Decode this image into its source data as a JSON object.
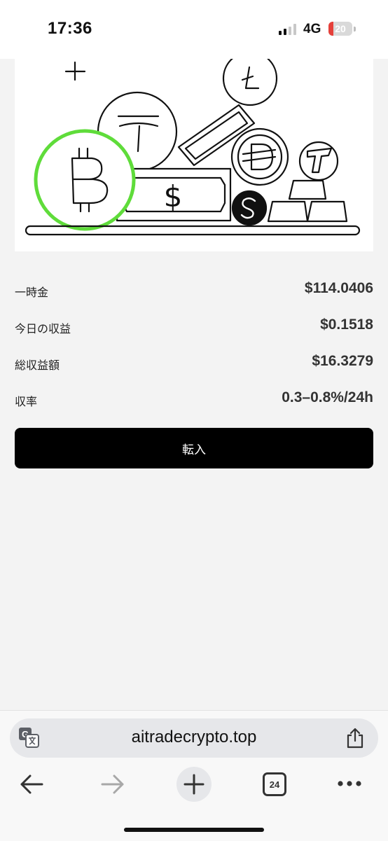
{
  "status_bar": {
    "time": "17:36",
    "network": "4G",
    "battery": "20",
    "battery_level": 0.2
  },
  "hero": {
    "icons": [
      "bitcoin-coin",
      "tether-coin",
      "litecoin-coin",
      "gold-bar",
      "dai-coin",
      "tron-coin",
      "dollar-bill",
      "sonic-coin",
      "gold-ingots",
      "plus-sign"
    ]
  },
  "stats": [
    {
      "label": "一時金",
      "value": "$114.0406"
    },
    {
      "label": "今日の収益",
      "value": "$0.1518"
    },
    {
      "label": "総収益額",
      "value": "$16.3279"
    },
    {
      "label": "収率",
      "value": "0.3–0.8%/24h"
    }
  ],
  "transfer_button": {
    "label": "転入"
  },
  "browser": {
    "url": "aitradecrypto.top",
    "tab_count": "24"
  },
  "colors": {
    "accent": "#000000",
    "bitcoin_ring": "#5fdc3a",
    "background": "#f3f3f3"
  }
}
